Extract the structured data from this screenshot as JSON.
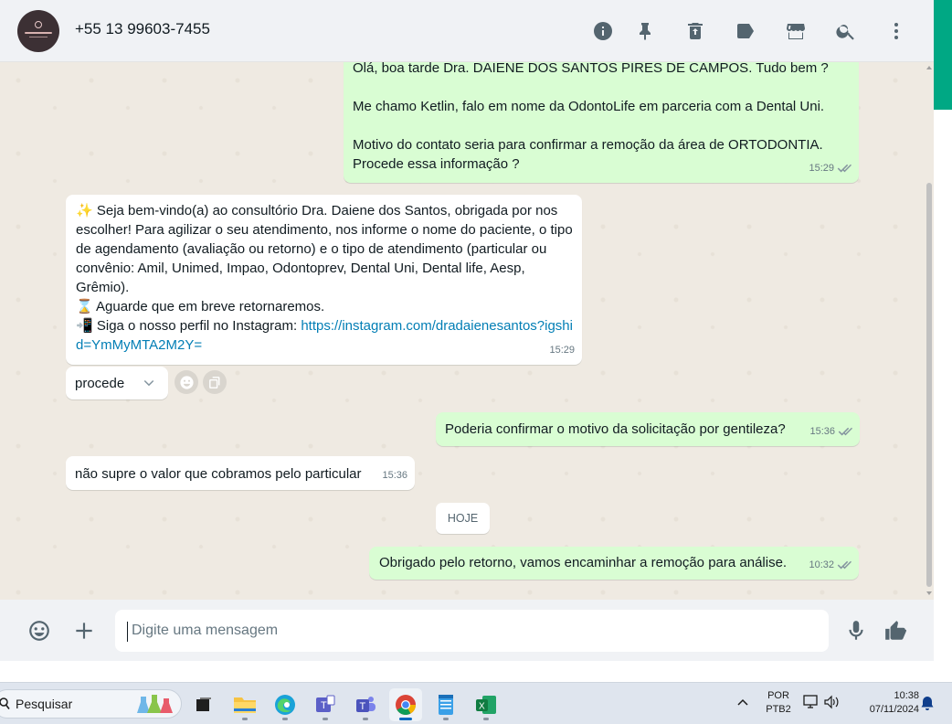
{
  "header": {
    "contact_name": "+55 13 99603-7455",
    "icons": [
      "info-icon",
      "pin-icon",
      "delete-icon",
      "label-icon",
      "catalog-icon",
      "search-icon",
      "menu-icon"
    ]
  },
  "messages": [
    {
      "direction": "outgoing",
      "text": "Olá, boa tarde Dra. DAIENE DOS SANTOS PIRES DE CAMPOS. Tudo bem ?\n\nMe chamo Ketlin, falo em nome da OdontoLife em parceria com a Dental Uni.\n\nMotivo do contato seria para confirmar a remoção da área de ORTODONTIA.\nProcede essa informação ?",
      "time": "15:29"
    },
    {
      "direction": "incoming",
      "text_parts": {
        "sparkles": "✨",
        "welcome": " Seja bem-vindo(a) ao consultório Dra. Daiene dos Santos, obrigada por nos escolher! Para agilizar o seu atendimento, nos informe o nome do paciente, o tipo de agendamento (avaliação ou retorno) e o tipo de atendimento (particular ou convênio: Amil, Unimed, Impao, Odontoprev, Dental Uni, Dental life, Aesp, Grêmio).",
        "hourglass": "⌛",
        "await": " Aguarde que em breve retornaremos.",
        "phone": "📲",
        "instagram_prefix": " Siga o nosso perfil no Instagram: ",
        "instagram_link": "https://instagram.com/dradaienesantos?igshid=YmMyMTA2M2Y="
      },
      "time": "15:29"
    },
    {
      "direction": "incoming",
      "text": "procede",
      "time": ""
    },
    {
      "direction": "outgoing",
      "text": "Poderia confirmar o motivo da solicitação por gentileza?",
      "time": "15:36"
    },
    {
      "direction": "incoming",
      "text": "não supre o valor que cobramos pelo particular",
      "time": "15:36"
    },
    {
      "direction": "outgoing",
      "text": "Obrigado pelo retorno, vamos encaminhar a remoção para análise.",
      "time": "10:32"
    }
  ],
  "day_separator": "HOJE",
  "composer": {
    "placeholder": "Digite uma mensagem"
  },
  "taskbar": {
    "search_label": "Pesquisar",
    "language": "POR",
    "keyboard": "PTB2",
    "time": "10:38",
    "date": "07/11/2024",
    "apps": [
      "task-view",
      "file-explorer",
      "edge",
      "teams-classic",
      "teams",
      "chrome",
      "notepad",
      "excel"
    ],
    "active_app": "chrome"
  },
  "colors": {
    "outgoing_bubble": "#d9fdd3",
    "incoming_bubble": "#ffffff",
    "chat_background": "#efeae2",
    "header_background": "#f0f2f5",
    "accent_green": "#00a884",
    "link": "#027eb5"
  }
}
